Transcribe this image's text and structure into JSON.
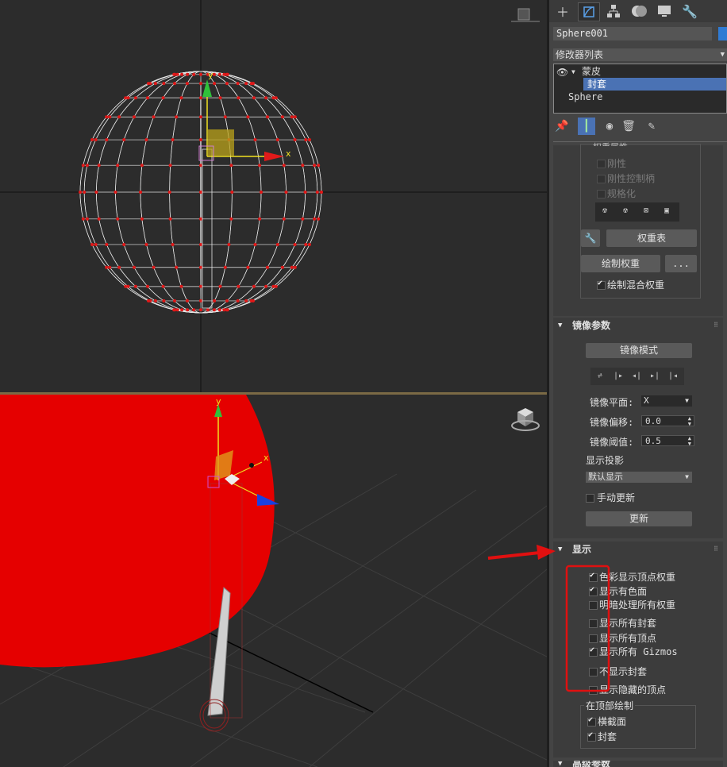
{
  "viewport_top": {
    "gizmo_x": "x",
    "gizmo_y": "y"
  },
  "viewport_bottom": {
    "gizmo_x": "x",
    "gizmo_y": "y"
  },
  "panel": {
    "object_name": "Sphere001",
    "object_color": "#2f7bd4",
    "modifier_list_label": "修改器列表",
    "stack": {
      "skin": "蒙皮",
      "envelope": "封套",
      "base": "Sphere"
    },
    "weight_properties": {
      "partial_header": "权重属性",
      "rigid": "刚性",
      "rigid_handles": "刚性控制柄",
      "normalize": "规格化",
      "weight_table_button": "权重表",
      "paint_weights_button": "绘制权重",
      "ellipsis_button": "...",
      "paint_blend_weights": "绘制混合权重"
    },
    "mirror": {
      "title": "镜像参数",
      "mode_button": "镜像模式",
      "plane_label": "镜像平面:",
      "plane_value": "X",
      "offset_label": "镜像偏移:",
      "offset_value": "0.0",
      "threshold_label": "镜像阈值:",
      "threshold_value": "0.5",
      "projection_label": "显示投影",
      "projection_value": "默认显示",
      "manual_update": "手动更新",
      "update_button": "更新"
    },
    "display": {
      "title": "显示",
      "options": [
        {
          "label": "色彩显示顶点权重",
          "checked": true
        },
        {
          "label": "显示有色面",
          "checked": true
        },
        {
          "label": "明暗处理所有权重",
          "checked": false
        },
        {
          "label": "显示所有封套",
          "checked": false
        },
        {
          "label": "显示所有顶点",
          "checked": false
        },
        {
          "label": "显示所有 Gizmos",
          "checked": true
        },
        {
          "label": "不显示封套",
          "checked": false
        },
        {
          "label": "显示隐藏的顶点",
          "checked": false
        }
      ],
      "draw_on_top": {
        "title": "在顶部绘制",
        "cross_sections": "横截面",
        "envelopes": "封套"
      }
    },
    "advanced_title": "高级参数"
  }
}
